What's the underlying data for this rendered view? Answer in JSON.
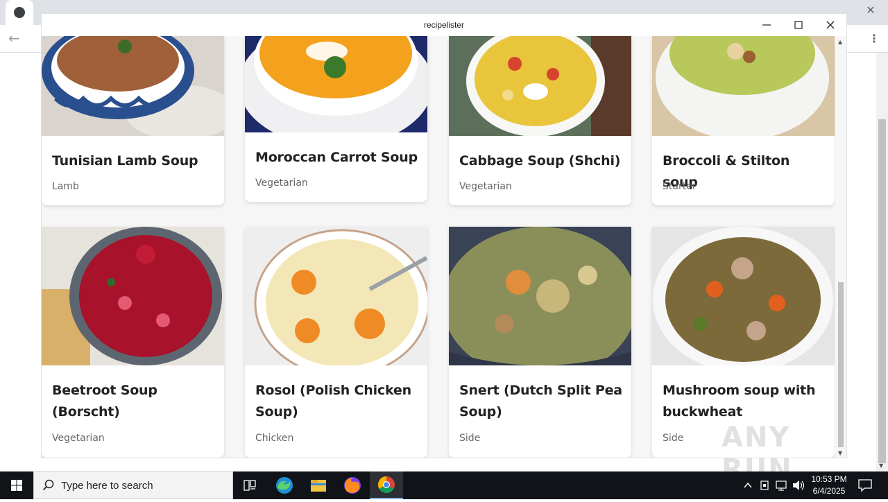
{
  "app": {
    "title": "recipelister"
  },
  "recipes": [
    {
      "name": "Tunisian Lamb Soup",
      "category": "Lamb"
    },
    {
      "name": "Moroccan Carrot Soup",
      "category": "Vegetarian"
    },
    {
      "name": "Cabbage Soup (Shchi)",
      "category": "Vegetarian"
    },
    {
      "name": "Broccoli & Stilton soup",
      "category": "Starter"
    },
    {
      "name": "Beetroot Soup (Borscht)",
      "category": "Vegetarian"
    },
    {
      "name": "Rosol (Polish Chicken Soup)",
      "category": "Chicken"
    },
    {
      "name": "Snert (Dutch Split Pea Soup)",
      "category": "Side"
    },
    {
      "name": "Mushroom soup with buckwheat",
      "category": "Side"
    }
  ],
  "taskbar": {
    "search_placeholder": "Type here to search",
    "time": "10:53 PM",
    "date": "6/4/2025"
  },
  "watermark": "ANY RUN"
}
